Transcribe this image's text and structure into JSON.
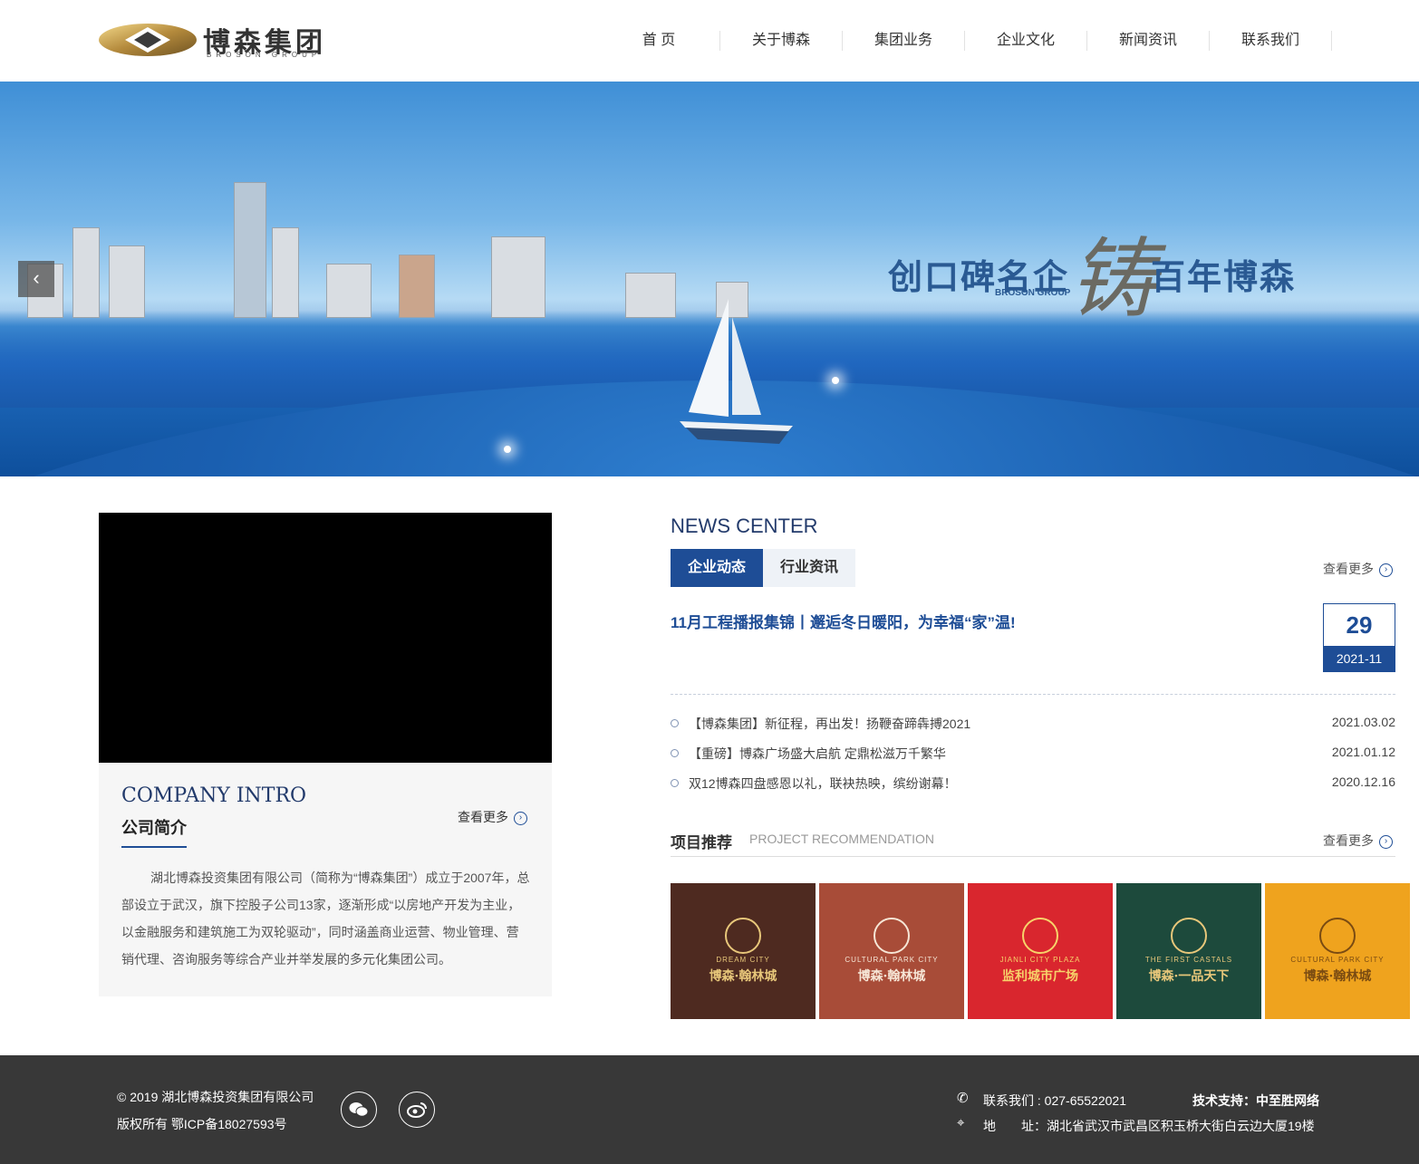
{
  "header": {
    "logo_cn": "博森集团",
    "logo_en": "BROSON GROUP",
    "nav": [
      "首 页",
      "关于博森",
      "集团业务",
      "企业文化",
      "新闻资讯",
      "联系我们"
    ]
  },
  "banner": {
    "slogan_left": "创口碑名企",
    "slogan_big": "铸",
    "slogan_right": "百年博森",
    "slogan_en": "BROSON GROUP",
    "prev_icon": "‹"
  },
  "intro": {
    "title_en": "COMPANY INTRO",
    "title_cn": "公司简介",
    "more": "查看更多",
    "text": "湖北博森投资集团有限公司（简称为“博森集团”）成立于2007年，总部设立于武汉，旗下控股子公司13家，逐渐形成“以房地产开发为主业，以金融服务和建筑施工为双轮驱动”，同时涵盖商业运营、物业管理、营销代理、咨询服务等综合产业并举发展的多元化集团公司。"
  },
  "news": {
    "title": "NEWS CENTER",
    "tabs": [
      "企业动态",
      "行业资讯"
    ],
    "more": "查看更多",
    "headline": "11月工程播报集锦丨邂逅冬日暖阳，为幸福“家”温!",
    "headline_day": "29",
    "headline_ym": "2021-11",
    "items": [
      {
        "title": "【博森集团】新征程，再出发！扬鞭奋蹄犇搏2021",
        "date": "2021.03.02"
      },
      {
        "title": "【重磅】博森广场盛大启航 定鼎松滋万千繁华",
        "date": "2021.01.12"
      },
      {
        "title": "双12博森四盘感恩以礼，联袂热映，缤纷谢幕！",
        "date": "2020.12.16"
      }
    ]
  },
  "projects": {
    "title_cn": "项目推荐",
    "title_en": "PROJECT RECOMMENDATION",
    "more": "查看更多",
    "tiles": [
      {
        "name": "博森·翰林城",
        "sub": "DREAM CITY",
        "bg": "#4e2a20",
        "fg": "#e8c77a"
      },
      {
        "name": "博森·翰林城",
        "sub": "CULTURAL PARK CITY",
        "bg": "#a84c38",
        "fg": "#f6e6d6"
      },
      {
        "name": "监利城市广场",
        "sub": "JIANLI CITY PLAZA",
        "bg": "#d9262e",
        "fg": "#f7d36a"
      },
      {
        "name": "博森·一品天下",
        "sub": "THE FIRST CASTALS",
        "bg": "#1d4a3c",
        "fg": "#e8c77a"
      },
      {
        "name": "博森·翰林城",
        "sub": "CULTURAL PARK CITY",
        "bg": "#efa31e",
        "fg": "#7a4b12"
      }
    ]
  },
  "footer": {
    "copyright": "© 2019 湖北博森投资集团有限公司",
    "icp": "版权所有 鄂ICP备18027593号",
    "contact": "联系我们 : 027-65522021",
    "tech": "技术支持：中至胜网络",
    "address": "地　　址：湖北省武汉市武昌区积玉桥大街白云边大厦19楼",
    "wechat_icon": "wechat-icon",
    "weibo_icon": "weibo-icon"
  },
  "colors": {
    "accent": "#1e4d96",
    "footer_bg": "#383838"
  }
}
